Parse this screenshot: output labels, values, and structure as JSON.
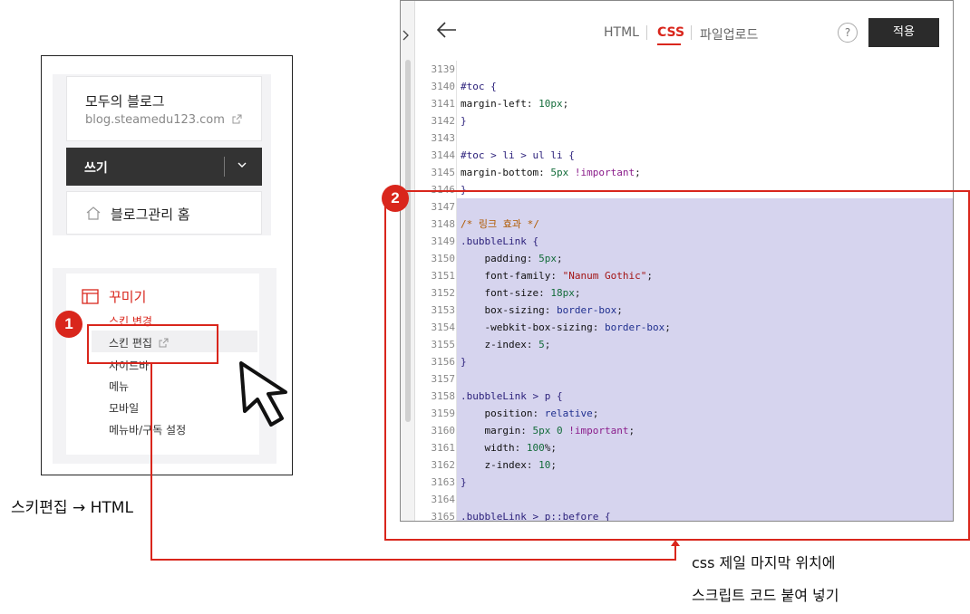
{
  "left_panel": {
    "blog_title": "모두의 블로그",
    "blog_url": "blog.steamedu123.com",
    "external_link_icon": "external-link-icon",
    "write_button": "쓰기",
    "admin_home": "블로그관리 홈",
    "decorate_section": {
      "title": "꾸미기",
      "items": [
        "스킨 변경",
        "스킨 편집",
        "사이드바",
        "메뉴",
        "모바일",
        "메뉴바/구독 설정"
      ]
    }
  },
  "editor": {
    "tabs": [
      "HTML",
      "CSS",
      "파일업로드"
    ],
    "active_tab": "CSS",
    "help_label": "?",
    "apply_button": "적용",
    "code_lines": [
      {
        "n": "3139",
        "t": ""
      },
      {
        "n": "3140",
        "t": "#toc {"
      },
      {
        "n": "3141",
        "t": "margin-left: 10px;"
      },
      {
        "n": "3142",
        "t": "}"
      },
      {
        "n": "3143",
        "t": ""
      },
      {
        "n": "3144",
        "t": "#toc > li > ul li {"
      },
      {
        "n": "3145",
        "t": "margin-bottom: 5px !important;"
      },
      {
        "n": "3146",
        "t": "}"
      },
      {
        "n": "3147",
        "t": ""
      },
      {
        "n": "3148",
        "t": "/* 링크 효과 */"
      },
      {
        "n": "3149",
        "t": ".bubbleLink {"
      },
      {
        "n": "3150",
        "t": "    padding: 5px;"
      },
      {
        "n": "3151",
        "t": "    font-family: \"Nanum Gothic\";"
      },
      {
        "n": "3152",
        "t": "    font-size: 18px;"
      },
      {
        "n": "3153",
        "t": "    box-sizing: border-box;"
      },
      {
        "n": "3154",
        "t": "    -webkit-box-sizing: border-box;"
      },
      {
        "n": "3155",
        "t": "    z-index: 5;"
      },
      {
        "n": "3156",
        "t": "}"
      },
      {
        "n": "3157",
        "t": ""
      },
      {
        "n": "3158",
        "t": ".bubbleLink > p {"
      },
      {
        "n": "3159",
        "t": "    position: relative;"
      },
      {
        "n": "3160",
        "t": "    margin: 5px 0 !important;"
      },
      {
        "n": "3161",
        "t": "    width: 100%;"
      },
      {
        "n": "3162",
        "t": "    z-index: 10;"
      },
      {
        "n": "3163",
        "t": "}"
      },
      {
        "n": "3164",
        "t": ""
      },
      {
        "n": "3165",
        "t": ".bubbleLink > p::before {"
      }
    ],
    "highlight_color": "#d6d4ee"
  },
  "annotations": {
    "badge_1": "1",
    "badge_2": "2",
    "caption_left": "스키편집 → HTML",
    "caption_right_line1": "css 제일 마지막 위치에",
    "caption_right_line2": "스크립트 코드 붙여 넣기",
    "accent_color": "#d9261c"
  }
}
